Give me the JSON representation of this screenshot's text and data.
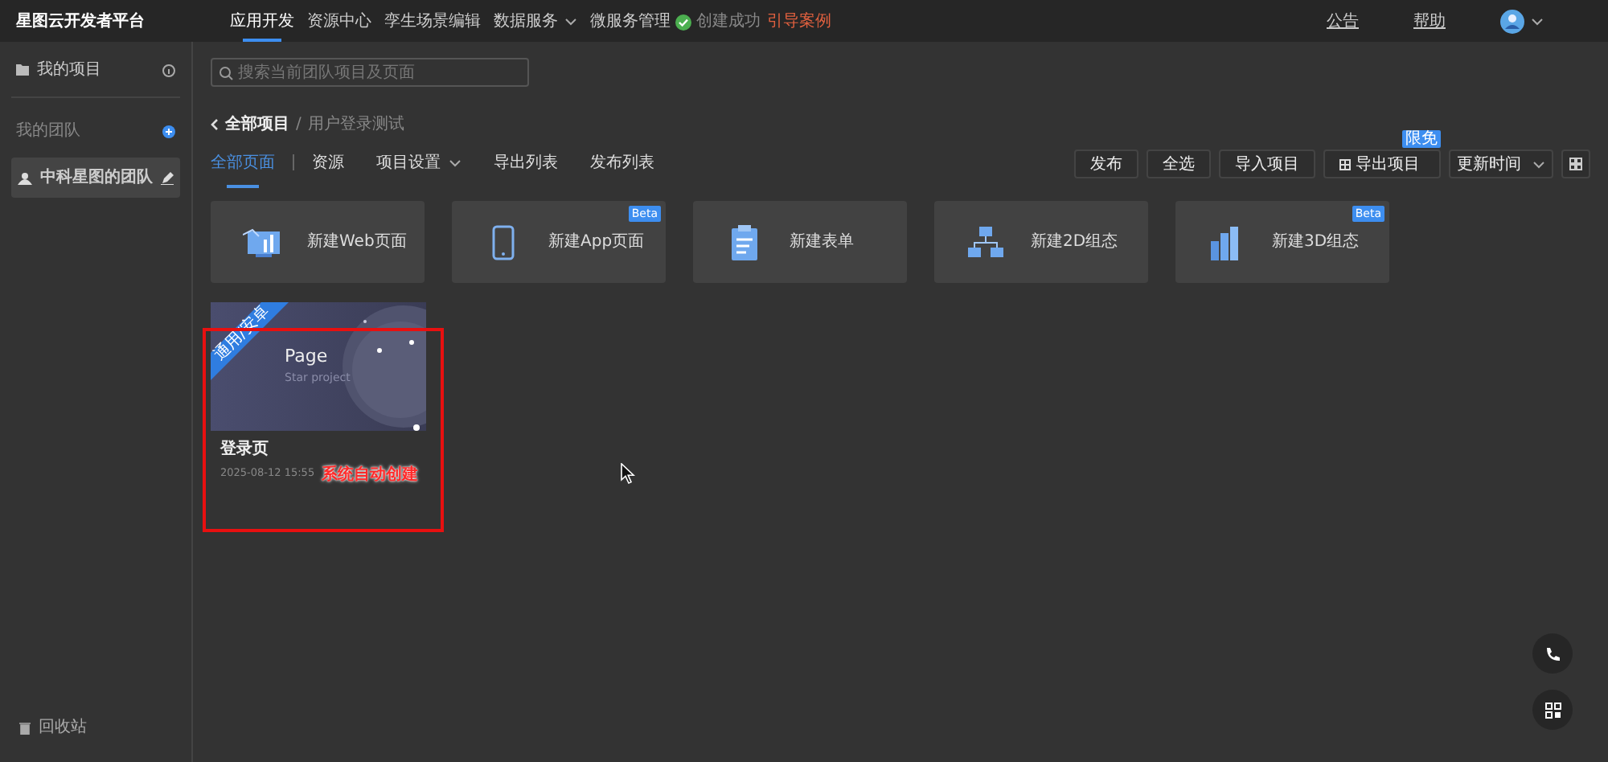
{
  "app": {
    "title": "星图云开发者平台"
  },
  "top_nav": [
    {
      "label": "应用开发",
      "selected": true,
      "dropdown": false,
      "highlighted": false
    },
    {
      "label": "资源中心",
      "selected": false,
      "dropdown": false,
      "highlighted": false
    },
    {
      "label": "孪生场景编辑",
      "selected": false,
      "dropdown": false,
      "highlighted": false
    },
    {
      "label": "数据服务",
      "selected": false,
      "dropdown": true,
      "highlighted": false
    },
    {
      "label": "微服务管理",
      "selected": false,
      "dropdown": false,
      "highlighted": false
    },
    {
      "label": "引导案例",
      "selected": false,
      "dropdown": false,
      "highlighted": true
    }
  ],
  "toast": {
    "text": "创建成功"
  },
  "top_right": [
    "公告",
    "帮助"
  ],
  "sidebar": {
    "my_projects": "我的项目",
    "team_heading": "我的团队",
    "teams": [
      {
        "label": "中科星图的团队",
        "selected": true
      }
    ],
    "recycle_bin": "回收站"
  },
  "search": {
    "placeholder": "搜索当前团队项目及页面"
  },
  "breadcrumb": {
    "root": "全部项目",
    "separator": "/",
    "current": "用户登录测试"
  },
  "tabs": [
    {
      "label": "全部页面",
      "selected": true,
      "dropdown": false
    },
    {
      "label": "资源",
      "selected": false,
      "dropdown": false
    },
    {
      "label": "项目设置",
      "selected": false,
      "dropdown": true
    },
    {
      "label": "导出列表",
      "selected": false,
      "dropdown": false
    },
    {
      "label": "发布列表",
      "selected": false,
      "dropdown": false
    }
  ],
  "actions": [
    {
      "label": "发布"
    },
    {
      "label": "全选"
    },
    {
      "label": "导入项目"
    },
    {
      "label": "导出项目",
      "badge": "限免"
    }
  ],
  "sort": {
    "label": "更新时间"
  },
  "create_cards": [
    {
      "label": "新建Web页面",
      "kind": "web"
    },
    {
      "label": "新建App页面",
      "kind": "app",
      "badge": "Beta"
    },
    {
      "label": "新建表单",
      "kind": "form"
    },
    {
      "label": "新建2D组态",
      "kind": "diagram"
    },
    {
      "label": "新建3D组态",
      "kind": "chart3d",
      "badge": "Beta"
    }
  ],
  "pages": [
    {
      "name": "登录页",
      "date": "2025-08-12 15:55",
      "thumb_title": "Page",
      "thumb_subtitle": "Star project",
      "ribbon": "通用/安卓"
    }
  ],
  "annotation": {
    "text": "系统自动创建"
  }
}
